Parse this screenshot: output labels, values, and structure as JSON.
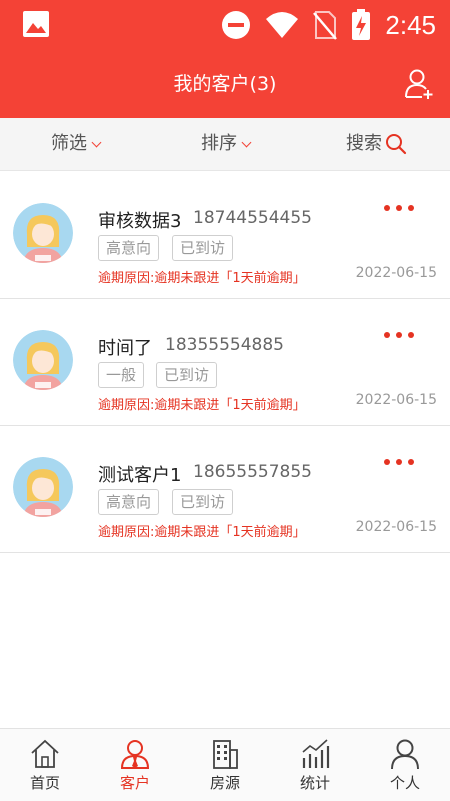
{
  "status_bar": {
    "time": "2:45"
  },
  "header": {
    "title": "我的客户(3)",
    "add_icon": "add-user-icon"
  },
  "filters": {
    "filter_label": "筛选",
    "sort_label": "排序",
    "search_label": "搜索"
  },
  "customers": [
    {
      "name": "审核数据3",
      "phone": "18744554455",
      "level": "高意向",
      "visit": "已到访",
      "reason": "逾期原因:逾期未跟进「1天前逾期」",
      "date": "2022-06-15"
    },
    {
      "name": "时间了",
      "phone": "18355554885",
      "level": "一般",
      "visit": "已到访",
      "reason": "逾期原因:逾期未跟进「1天前逾期」",
      "date": "2022-06-15"
    },
    {
      "name": "测试客户1",
      "phone": "18655557855",
      "level": "高意向",
      "visit": "已到访",
      "reason": "逾期原因:逾期未跟进「1天前逾期」",
      "date": "2022-06-15"
    }
  ],
  "tabs": [
    {
      "label": "首页",
      "icon": "home-icon"
    },
    {
      "label": "客户",
      "icon": "customer-icon",
      "active": true
    },
    {
      "label": "房源",
      "icon": "building-icon"
    },
    {
      "label": "统计",
      "icon": "stats-icon"
    },
    {
      "label": "个人",
      "icon": "person-icon"
    }
  ],
  "colors": {
    "brand": "#f44236",
    "accent_text": "#e53322"
  }
}
